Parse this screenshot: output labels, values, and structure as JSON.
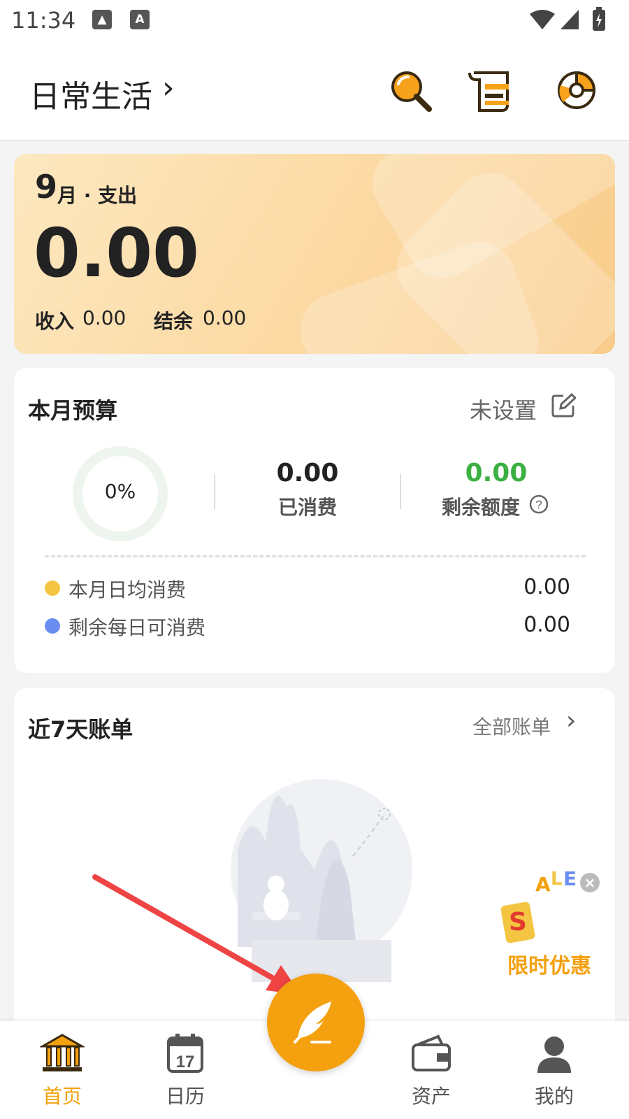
{
  "status": {
    "time": "11:34"
  },
  "header": {
    "book_title": "日常生活"
  },
  "summary": {
    "month": "9",
    "month_suffix": "月 · 支出",
    "expense": "0.00",
    "income_label": "收入",
    "income": "0.00",
    "balance_label": "结余",
    "balance": "0.00"
  },
  "budget": {
    "title": "本月预算",
    "status": "未设置",
    "percent": "0%",
    "spent_value": "0.00",
    "spent_label": "已消费",
    "remaining_value": "0.00",
    "remaining_label": "剩余额度",
    "daily_avg_label": "本月日均消费",
    "daily_avg_value": "0.00",
    "daily_left_label": "剩余每日可消费",
    "daily_left_value": "0.00",
    "colors": {
      "remaining": "#3cb043",
      "dot_yellow": "#f4c542",
      "dot_blue": "#6a8ef0"
    }
  },
  "recent": {
    "title": "近7天账单",
    "all_bills": "全部账单"
  },
  "promo": {
    "label": "限时优惠",
    "tag_letter": "S",
    "sale_letters": [
      "A",
      "L",
      "E"
    ]
  },
  "nav": [
    {
      "label": "首页",
      "icon": "bank-icon",
      "active": true
    },
    {
      "label": "日历",
      "icon": "calendar-icon",
      "active": false
    },
    {
      "label": "资产",
      "icon": "wallet-icon",
      "active": false
    },
    {
      "label": "我的",
      "icon": "user-icon",
      "active": false
    }
  ],
  "calendar_day": "17",
  "accent": "#f5a00e"
}
